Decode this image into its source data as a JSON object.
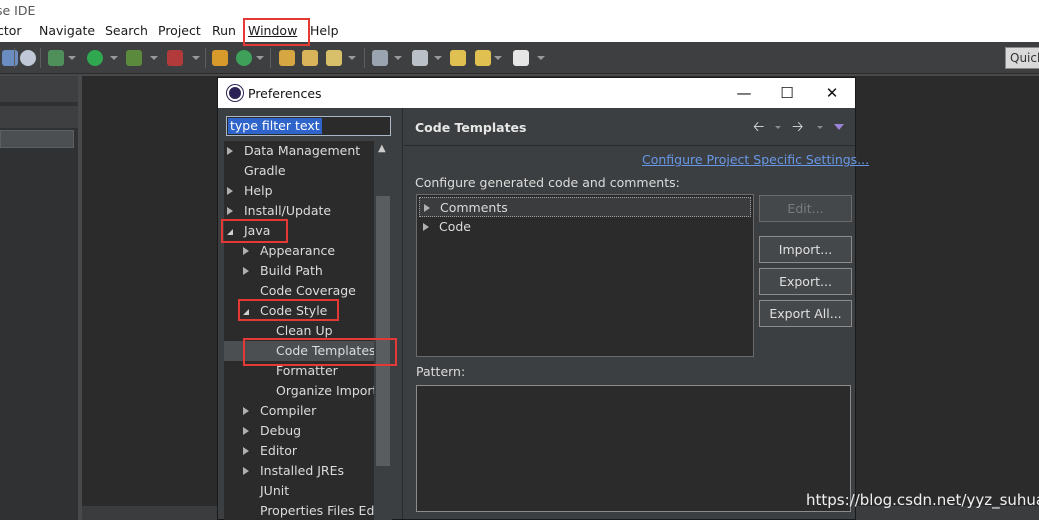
{
  "window": {
    "title_fragment": "se IDE"
  },
  "menubar": {
    "items": [
      "ctor",
      "Navigate",
      "Search",
      "Project",
      "Run",
      "Window",
      "Help"
    ]
  },
  "toolbar": {
    "quick_access": "Quick"
  },
  "dialog": {
    "title": "Preferences",
    "filter_placeholder": "type filter text",
    "tree": [
      {
        "label": "Data Management",
        "state": "closed",
        "level": 0
      },
      {
        "label": "Gradle",
        "state": "leaf",
        "level": 0
      },
      {
        "label": "Help",
        "state": "closed",
        "level": 0
      },
      {
        "label": "Install/Update",
        "state": "closed",
        "level": 0
      },
      {
        "label": "Java",
        "state": "open",
        "level": 0
      },
      {
        "label": "Appearance",
        "state": "closed",
        "level": 1
      },
      {
        "label": "Build Path",
        "state": "closed",
        "level": 1
      },
      {
        "label": "Code Coverage",
        "state": "leaf",
        "level": 1
      },
      {
        "label": "Code Style",
        "state": "open",
        "level": 1
      },
      {
        "label": "Clean Up",
        "state": "leaf",
        "level": 2
      },
      {
        "label": "Code Templates",
        "state": "leaf",
        "level": 2,
        "selected": true
      },
      {
        "label": "Formatter",
        "state": "leaf",
        "level": 2
      },
      {
        "label": "Organize Import",
        "state": "leaf",
        "level": 2
      },
      {
        "label": "Compiler",
        "state": "closed",
        "level": 1
      },
      {
        "label": "Debug",
        "state": "closed",
        "level": 1
      },
      {
        "label": "Editor",
        "state": "closed",
        "level": 1
      },
      {
        "label": "Installed JREs",
        "state": "closed",
        "level": 1
      },
      {
        "label": "JUnit",
        "state": "leaf",
        "level": 1
      },
      {
        "label": "Properties Files Edi",
        "state": "leaf",
        "level": 1
      }
    ],
    "page": {
      "title": "Code Templates",
      "configure_link": "Configure Project Specific Settings...",
      "configure_label": "Configure generated code and comments:",
      "templates": [
        "Comments",
        "Code"
      ],
      "buttons": {
        "edit": "Edit...",
        "import": "Import...",
        "export": "Export...",
        "export_all": "Export All..."
      },
      "pattern_label": "Pattern:"
    }
  },
  "watermark": "https://blog.csdn.net/yyz_suhua",
  "colors": {
    "annotation": "#e53935",
    "link": "#6897e8",
    "selection": "#2f65ca"
  }
}
